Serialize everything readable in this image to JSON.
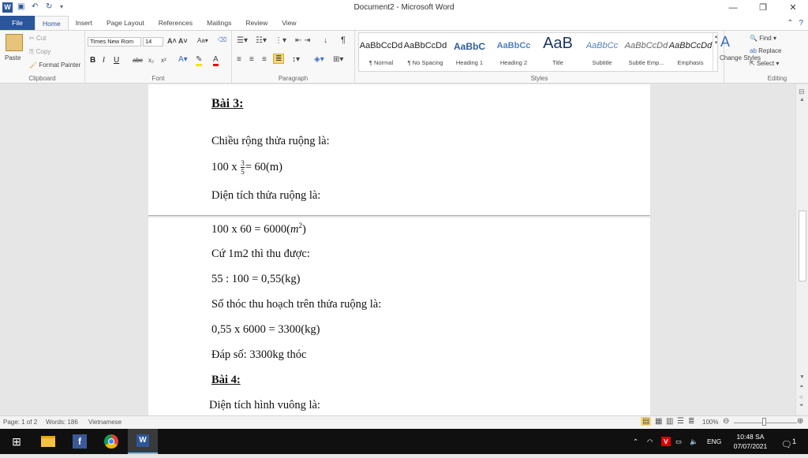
{
  "window": {
    "title": "Document2 - Microsoft Word",
    "minimize": "—",
    "restore": "❐",
    "close": "✕"
  },
  "quick_access": {
    "word_icon": "W",
    "save_icon": "save-icon",
    "undo_icon": "undo-icon",
    "redo_icon": "redo-icon"
  },
  "tabs": [
    "File",
    "Home",
    "Insert",
    "Page Layout",
    "References",
    "Mailings",
    "Review",
    "View"
  ],
  "ribbon": {
    "clipboard": {
      "label": "Clipboard",
      "paste": "Paste",
      "cut": "Cut",
      "copy": "Copy",
      "format_painter": "Format Painter"
    },
    "font": {
      "label": "Font",
      "font_name": "Times New Rom",
      "font_size": "14",
      "bold": "B",
      "italic": "I",
      "underline": "U",
      "strike": "abc",
      "subscript": "x₂",
      "superscript": "x²"
    },
    "paragraph": {
      "label": "Paragraph"
    },
    "styles": {
      "label": "Styles",
      "items": [
        {
          "preview": "AaBbCcDd",
          "name": "¶ Normal"
        },
        {
          "preview": "AaBbCcDd",
          "name": "¶ No Spacing"
        },
        {
          "preview": "AaBbC",
          "name": "Heading 1"
        },
        {
          "preview": "AaBbCc",
          "name": "Heading 2"
        },
        {
          "preview": "AaB",
          "name": "Title"
        },
        {
          "preview": "AaBbCc",
          "name": "Subtitle"
        },
        {
          "preview": "AaBbCcDd",
          "name": "Subtle Emp..."
        },
        {
          "preview": "AaBbCcDd",
          "name": "Emphasis"
        }
      ],
      "change_styles": "Change Styles"
    },
    "editing": {
      "label": "Editing",
      "find": "Find",
      "replace": "Replace",
      "select": "Select"
    }
  },
  "document": {
    "page1": {
      "heading": "Bài 3:",
      "line1": "Chiều rộng thửa ruộng là:",
      "line2_pre": "100 x",
      "line2_num": "3",
      "line2_den": "5",
      "line2_post": "= 60(m)",
      "line3": "Diện tích thửa ruộng là:"
    },
    "page2": {
      "line1_pre": "100 x 60 = 6000(",
      "line1_unit": "m",
      "line1_exp": "2",
      "line1_post": ")",
      "line2": "Cứ 1m2 thì thu được:",
      "line3": "55 : 100 = 0,55(kg)",
      "line4": "Số thóc thu hoạch trên thửa ruộng là:",
      "line5": "0,55 x 6000 = 3300(kg)",
      "line6": "Đáp số: 3300kg thóc",
      "heading2": "Bài 4:",
      "line7": "Diện tích hình vuông là:"
    }
  },
  "statusbar": {
    "page": "Page: 1 of 2",
    "words": "Words: 186",
    "language": "Vietnamese",
    "zoom": "100%"
  },
  "taskbar": {
    "lang": "ENG",
    "time": "10:48 SA",
    "date": "07/07/2021",
    "notifications": "1"
  }
}
